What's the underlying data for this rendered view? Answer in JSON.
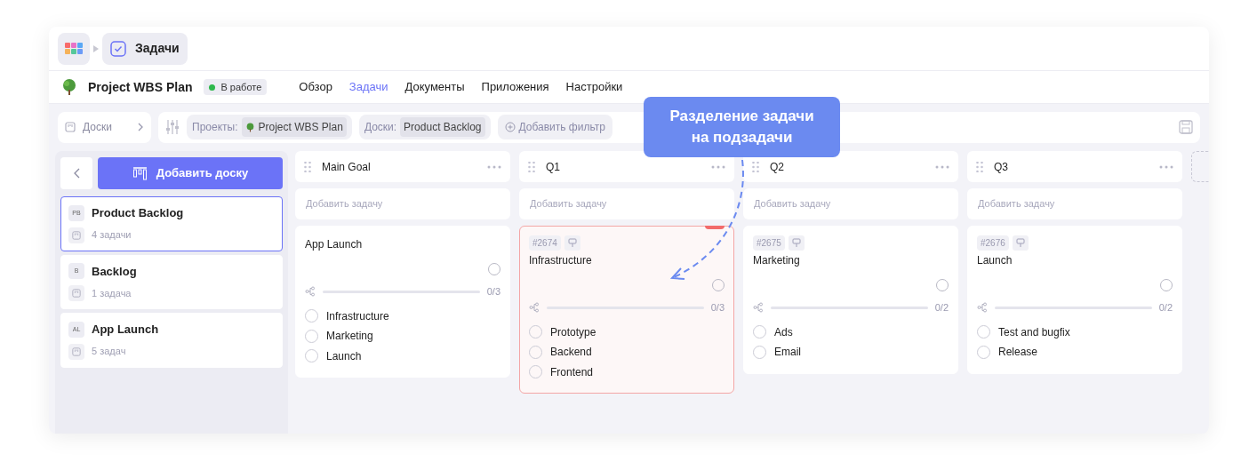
{
  "breadcrumb": {
    "title": "Задачи"
  },
  "project": {
    "name": "Project WBS Plan",
    "status": "В работе",
    "nav": [
      {
        "label": "Обзор",
        "selected": false
      },
      {
        "label": "Задачи",
        "selected": true
      },
      {
        "label": "Документы",
        "selected": false
      },
      {
        "label": "Приложения",
        "selected": false
      },
      {
        "label": "Настройки",
        "selected": false
      }
    ]
  },
  "filter_bar": {
    "boards_button": "Доски",
    "filters": [
      {
        "label": "Проекты:",
        "value": "Project WBS Plan",
        "kind": "project"
      },
      {
        "label": "Доски:",
        "value": "Product Backlog",
        "kind": "plain"
      }
    ],
    "add_filter": "Добавить фильтр"
  },
  "sidebar": {
    "add_button": "Добавить доску",
    "boards": [
      {
        "abbr": "PB",
        "name": "Product Backlog",
        "count": "4 задачи",
        "selected": true
      },
      {
        "abbr": "B",
        "name": "Backlog",
        "count": "1 задача",
        "selected": false
      },
      {
        "abbr": "AL",
        "name": "App Launch",
        "count": "5 задач",
        "selected": false
      }
    ]
  },
  "columns": [
    {
      "title": "Main Goal",
      "add_task": "Добавить задачу",
      "cards": [
        {
          "title": "App Launch",
          "highlighted": false,
          "progress": "0/3",
          "level": 0,
          "subtasks": [
            {
              "label": "Infrastructure",
              "checked": false
            },
            {
              "label": "Marketing",
              "checked": false
            },
            {
              "label": "Launch",
              "checked": false
            }
          ]
        }
      ]
    },
    {
      "title": "Q1",
      "add_task": "Добавить задачу",
      "cards": [
        {
          "id": "#2674",
          "title": "Infrastructure",
          "highlighted": true,
          "progress": "0/3",
          "level": 0,
          "subtasks": [
            {
              "label": "Prototype",
              "checked": false
            },
            {
              "label": "Backend",
              "checked": false
            },
            {
              "label": "Frontend",
              "checked": false
            }
          ]
        }
      ]
    },
    {
      "title": "Q2",
      "add_task": "Добавить задачу",
      "cards": [
        {
          "id": "#2675",
          "title": "Marketing",
          "highlighted": false,
          "progress": "0/2",
          "level": 0,
          "subtasks": [
            {
              "label": "Ads",
              "checked": false
            },
            {
              "label": "Email",
              "checked": false
            }
          ]
        }
      ]
    },
    {
      "title": "Q3",
      "add_task": "Добавить задачу",
      "cards": [
        {
          "id": "#2676",
          "title": "Launch",
          "highlighted": false,
          "progress": "0/2",
          "level": 0,
          "subtasks": [
            {
              "label": "Test and bugfix",
              "checked": false
            },
            {
              "label": "Release",
              "checked": false
            }
          ]
        }
      ]
    }
  ],
  "callout": {
    "text": "Разделение задачи на подзадачи"
  }
}
